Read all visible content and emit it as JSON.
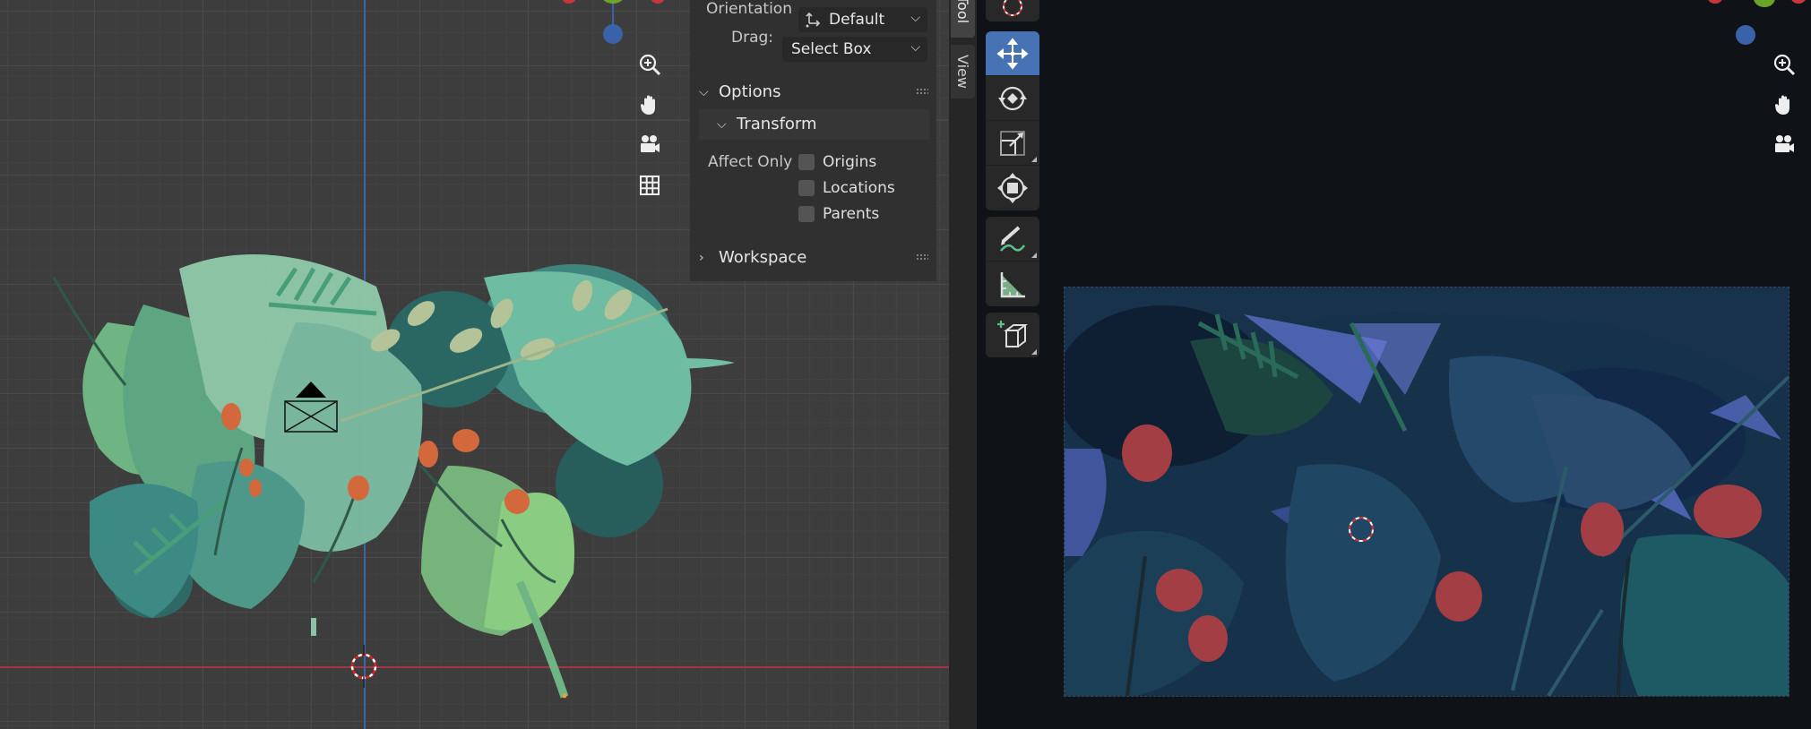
{
  "npanel": {
    "orientation": {
      "label": "Orientation",
      "value": "Default"
    },
    "drag": {
      "label": "Drag:",
      "value": "Select Box"
    },
    "options_label": "Options",
    "transform_label": "Transform",
    "affect_only_label": "Affect Only",
    "affect_only_items": [
      {
        "label": "Origins",
        "checked": false
      },
      {
        "label": "Locations",
        "checked": false
      },
      {
        "label": "Parents",
        "checked": false
      }
    ],
    "workspace_label": "Workspace"
  },
  "side_tabs": [
    {
      "label": "Tool",
      "active": true
    },
    {
      "label": "View",
      "active": false
    }
  ],
  "toolbar": {
    "tools": [
      "move-tool",
      "rotate-tool",
      "scale-tool",
      "transform-tool",
      "annotate-tool",
      "measure-tool",
      "add-cube-tool"
    ],
    "active_tool": "move-tool"
  },
  "colors": {
    "axis_x": "#a5353e",
    "axis_z": "#3f63a6",
    "active_tool": "#4772b3",
    "gizmo_x": "#c8363c",
    "gizmo_y": "#6aa52a",
    "gizmo_z": "#3a62a8"
  }
}
